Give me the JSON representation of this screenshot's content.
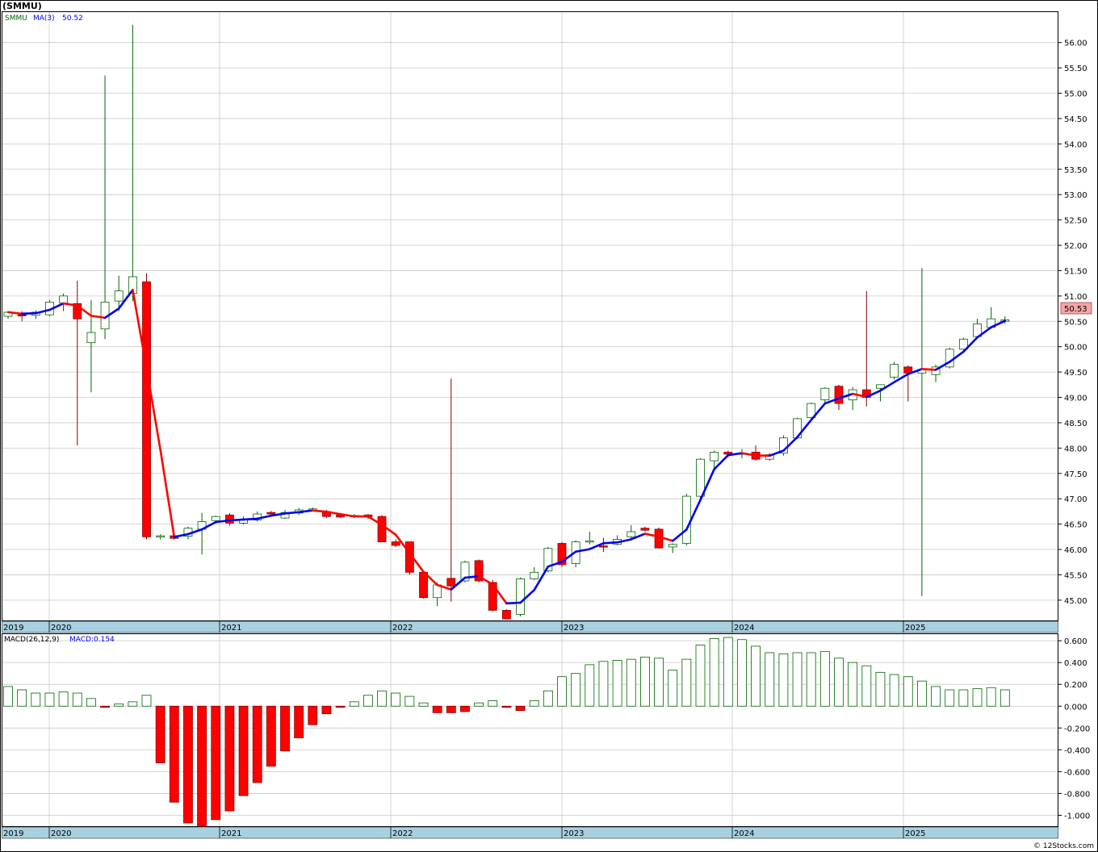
{
  "title": "(SMMU)",
  "price_panel": {
    "legend_symbol": "SMMU",
    "legend_ma": "MA(3)",
    "legend_ma_value": "50.52",
    "last_price_label": "50.53",
    "colors": {
      "up": "#006400",
      "down": "#ff0000",
      "ma_up": "#0000ee",
      "ma_down": "#ff0000",
      "grid": "#c8c8c8",
      "axis_band": "#a8d0e0"
    }
  },
  "macd_panel": {
    "legend_name": "MACD(26,12,9)",
    "legend_value": "MACD:0.154"
  },
  "footer": "© 12Stocks.com",
  "chart_data": [
    {
      "type": "candlestick",
      "series_name": "SMMU",
      "x_axis_labels": [
        "2019",
        "2020",
        "2021",
        "2022",
        "2023",
        "2024",
        "2025"
      ],
      "ylim": [
        44.6,
        56.6
      ],
      "y_ticks": [
        "45.00",
        "45.50",
        "46.00",
        "46.50",
        "47.00",
        "47.50",
        "48.00",
        "48.50",
        "49.00",
        "49.50",
        "50.00",
        "50.50",
        "51.00",
        "51.50",
        "52.00",
        "52.50",
        "53.00",
        "53.50",
        "54.00",
        "54.50",
        "55.00",
        "55.50",
        "56.00"
      ],
      "grid": true,
      "candles": [
        {
          "o": 50.6,
          "h": 50.7,
          "l": 50.55,
          "c": 50.68
        },
        {
          "o": 50.63,
          "h": 50.7,
          "l": 50.5,
          "c": 50.62
        },
        {
          "o": 50.62,
          "h": 50.72,
          "l": 50.55,
          "c": 50.68
        },
        {
          "o": 50.63,
          "h": 50.92,
          "l": 50.6,
          "c": 50.88
        },
        {
          "o": 50.86,
          "h": 51.05,
          "l": 50.7,
          "c": 51.0
        },
        {
          "o": 50.85,
          "h": 51.3,
          "l": 48.05,
          "c": 50.55
        },
        {
          "o": 50.08,
          "h": 50.92,
          "l": 49.1,
          "c": 50.28
        },
        {
          "o": 50.35,
          "h": 55.35,
          "l": 50.15,
          "c": 50.88
        },
        {
          "o": 50.9,
          "h": 51.4,
          "l": 50.7,
          "c": 51.1
        },
        {
          "o": 51.05,
          "h": 56.35,
          "l": 50.9,
          "c": 51.38
        },
        {
          "o": 51.28,
          "h": 51.45,
          "l": 46.2,
          "c": 46.25
        },
        {
          "o": 46.25,
          "h": 46.3,
          "l": 46.2,
          "c": 46.27
        },
        {
          "o": 46.27,
          "h": 46.33,
          "l": 46.19,
          "c": 46.22
        },
        {
          "o": 46.26,
          "h": 46.45,
          "l": 46.2,
          "c": 46.42
        },
        {
          "o": 46.4,
          "h": 46.72,
          "l": 45.9,
          "c": 46.55
        },
        {
          "o": 46.57,
          "h": 46.67,
          "l": 46.52,
          "c": 46.65
        },
        {
          "o": 46.68,
          "h": 46.72,
          "l": 46.47,
          "c": 46.52
        },
        {
          "o": 46.52,
          "h": 46.65,
          "l": 46.49,
          "c": 46.6
        },
        {
          "o": 46.58,
          "h": 46.75,
          "l": 46.55,
          "c": 46.7
        },
        {
          "o": 46.73,
          "h": 46.76,
          "l": 46.68,
          "c": 46.7
        },
        {
          "o": 46.62,
          "h": 46.78,
          "l": 46.6,
          "c": 46.73
        },
        {
          "o": 46.72,
          "h": 46.82,
          "l": 46.68,
          "c": 46.78
        },
        {
          "o": 46.8,
          "h": 46.83,
          "l": 46.75,
          "c": 46.8
        },
        {
          "o": 46.75,
          "h": 46.78,
          "l": 46.62,
          "c": 46.65
        },
        {
          "o": 46.68,
          "h": 46.7,
          "l": 46.62,
          "c": 46.64
        },
        {
          "o": 46.65,
          "h": 46.7,
          "l": 46.62,
          "c": 46.67
        },
        {
          "o": 46.68,
          "h": 46.7,
          "l": 46.6,
          "c": 46.64
        },
        {
          "o": 46.65,
          "h": 46.68,
          "l": 46.15,
          "c": 46.15
        },
        {
          "o": 46.15,
          "h": 46.2,
          "l": 46.05,
          "c": 46.08
        },
        {
          "o": 46.15,
          "h": 46.15,
          "l": 45.5,
          "c": 45.55
        },
        {
          "o": 45.55,
          "h": 45.56,
          "l": 45.03,
          "c": 45.05
        },
        {
          "o": 45.05,
          "h": 45.35,
          "l": 44.88,
          "c": 45.3
        },
        {
          "o": 45.43,
          "h": 49.37,
          "l": 44.97,
          "c": 45.28
        },
        {
          "o": 45.38,
          "h": 45.78,
          "l": 45.35,
          "c": 45.75
        },
        {
          "o": 45.78,
          "h": 45.8,
          "l": 45.35,
          "c": 45.38
        },
        {
          "o": 45.35,
          "h": 45.4,
          "l": 44.78,
          "c": 44.8
        },
        {
          "o": 44.8,
          "h": 44.82,
          "l": 44.63,
          "c": 44.63
        },
        {
          "o": 44.72,
          "h": 45.45,
          "l": 44.68,
          "c": 45.42
        },
        {
          "o": 45.42,
          "h": 45.65,
          "l": 45.4,
          "c": 45.55
        },
        {
          "o": 45.58,
          "h": 46.05,
          "l": 45.55,
          "c": 46.02
        },
        {
          "o": 46.12,
          "h": 46.15,
          "l": 45.65,
          "c": 45.7
        },
        {
          "o": 45.72,
          "h": 46.18,
          "l": 45.65,
          "c": 46.15
        },
        {
          "o": 46.15,
          "h": 46.35,
          "l": 46.1,
          "c": 46.17
        },
        {
          "o": 46.07,
          "h": 46.23,
          "l": 45.95,
          "c": 46.05
        },
        {
          "o": 46.1,
          "h": 46.28,
          "l": 46.08,
          "c": 46.2
        },
        {
          "o": 46.25,
          "h": 46.48,
          "l": 46.2,
          "c": 46.35
        },
        {
          "o": 46.42,
          "h": 46.45,
          "l": 46.35,
          "c": 46.38
        },
        {
          "o": 46.4,
          "h": 46.43,
          "l": 46.02,
          "c": 46.03
        },
        {
          "o": 46.05,
          "h": 46.12,
          "l": 45.93,
          "c": 46.1
        },
        {
          "o": 46.12,
          "h": 47.1,
          "l": 46.08,
          "c": 47.05
        },
        {
          "o": 47.05,
          "h": 47.8,
          "l": 47.0,
          "c": 47.78
        },
        {
          "o": 47.75,
          "h": 47.95,
          "l": 47.6,
          "c": 47.92
        },
        {
          "o": 47.92,
          "h": 47.95,
          "l": 47.82,
          "c": 47.88
        },
        {
          "o": 47.9,
          "h": 47.98,
          "l": 47.8,
          "c": 47.9
        },
        {
          "o": 47.92,
          "h": 48.05,
          "l": 47.75,
          "c": 47.78
        },
        {
          "o": 47.78,
          "h": 47.9,
          "l": 47.75,
          "c": 47.87
        },
        {
          "o": 47.9,
          "h": 48.25,
          "l": 47.85,
          "c": 48.2
        },
        {
          "o": 48.2,
          "h": 48.6,
          "l": 48.18,
          "c": 48.58
        },
        {
          "o": 48.6,
          "h": 48.9,
          "l": 48.55,
          "c": 48.88
        },
        {
          "o": 48.95,
          "h": 49.2,
          "l": 48.9,
          "c": 49.18
        },
        {
          "o": 49.22,
          "h": 49.25,
          "l": 48.75,
          "c": 48.88
        },
        {
          "o": 48.95,
          "h": 49.2,
          "l": 48.75,
          "c": 49.15
        },
        {
          "o": 49.15,
          "h": 51.1,
          "l": 48.82,
          "c": 49.0
        },
        {
          "o": 49.18,
          "h": 49.25,
          "l": 48.92,
          "c": 49.25
        },
        {
          "o": 49.4,
          "h": 49.7,
          "l": 49.35,
          "c": 49.65
        },
        {
          "o": 49.6,
          "h": 49.63,
          "l": 48.92,
          "c": 49.48
        },
        {
          "o": 49.48,
          "h": 51.55,
          "l": 45.08,
          "c": 49.55
        },
        {
          "o": 49.45,
          "h": 49.65,
          "l": 49.3,
          "c": 49.6
        },
        {
          "o": 49.6,
          "h": 49.98,
          "l": 49.57,
          "c": 49.95
        },
        {
          "o": 49.95,
          "h": 50.18,
          "l": 49.92,
          "c": 50.15
        },
        {
          "o": 50.2,
          "h": 50.55,
          "l": 50.18,
          "c": 50.45
        },
        {
          "o": 50.38,
          "h": 50.78,
          "l": 50.35,
          "c": 50.55
        },
        {
          "o": 50.5,
          "h": 50.6,
          "l": 50.45,
          "c": 50.53
        }
      ]
    },
    {
      "type": "bar",
      "series_name": "MACD(26,12,9)",
      "ylim": [
        -1.1,
        0.66
      ],
      "y_ticks": [
        "0.600",
        "0.400",
        "0.200",
        "0.000",
        "-0.200",
        "-0.400",
        "-0.600",
        "-0.800",
        "-1.000"
      ],
      "values": [
        0.18,
        0.15,
        0.12,
        0.12,
        0.13,
        0.12,
        0.07,
        -0.01,
        0.02,
        0.04,
        0.1,
        -0.52,
        -0.88,
        -1.07,
        -1.1,
        -1.04,
        -0.96,
        -0.82,
        -0.7,
        -0.55,
        -0.41,
        -0.29,
        -0.17,
        -0.07,
        -0.01,
        0.04,
        0.1,
        0.14,
        0.12,
        0.09,
        0.03,
        -0.06,
        -0.06,
        -0.05,
        0.03,
        0.05,
        -0.01,
        -0.04,
        0.05,
        0.14,
        0.27,
        0.3,
        0.38,
        0.41,
        0.42,
        0.43,
        0.45,
        0.44,
        0.33,
        0.43,
        0.56,
        0.62,
        0.63,
        0.61,
        0.55,
        0.49,
        0.48,
        0.49,
        0.49,
        0.5,
        0.44,
        0.4,
        0.37,
        0.31,
        0.29,
        0.27,
        0.23,
        0.18,
        0.15,
        0.15,
        0.16,
        0.17,
        0.15
      ]
    }
  ]
}
